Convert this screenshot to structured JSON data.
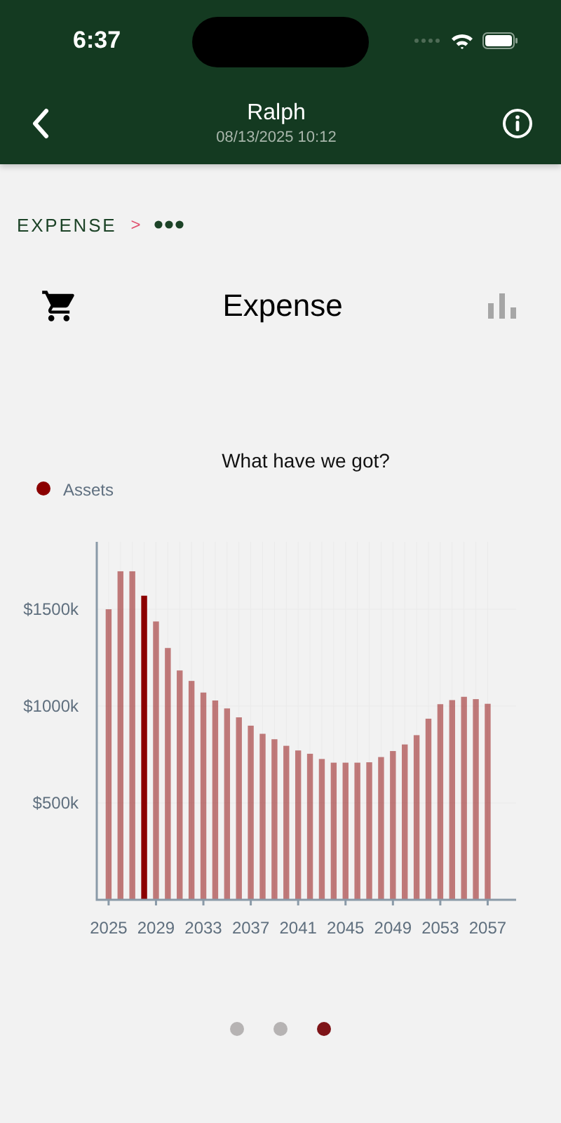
{
  "status_bar": {
    "time": "6:37"
  },
  "nav": {
    "title": "Ralph",
    "subtitle": "08/13/2025 10:12"
  },
  "breadcrumb": {
    "items": [
      "EXPENSE"
    ],
    "separator": ">"
  },
  "page": {
    "title": "Expense"
  },
  "chart": {
    "chart_data": {
      "type": "bar",
      "title": "What have we got?",
      "x": [
        2025,
        2026,
        2027,
        2028,
        2029,
        2030,
        2031,
        2032,
        2033,
        2034,
        2035,
        2036,
        2037,
        2038,
        2039,
        2040,
        2041,
        2042,
        2043,
        2044,
        2045,
        2046,
        2047,
        2048,
        2049,
        2050,
        2051,
        2052,
        2053,
        2054,
        2055,
        2056,
        2057
      ],
      "series": [
        {
          "name": "Assets",
          "color": "#8b0000",
          "values": [
            1500,
            1696,
            1696,
            1570,
            1437,
            1300,
            1184,
            1130,
            1070,
            1029,
            988,
            942,
            899,
            857,
            829,
            795,
            771,
            754,
            727,
            708,
            708,
            708,
            710,
            737,
            768,
            802,
            850,
            935,
            1010,
            1031,
            1048,
            1036,
            1012
          ]
        }
      ],
      "ylim": [
        0,
        1848
      ],
      "yticks": [
        {
          "value": 500,
          "label": "$500k"
        },
        {
          "value": 1000,
          "label": "$1000k"
        },
        {
          "value": 1500,
          "label": "$1500k"
        }
      ],
      "xticks": [
        2025,
        2029,
        2033,
        2037,
        2041,
        2045,
        2049,
        2053,
        2057
      ],
      "xlim": [
        2024,
        2059.4
      ],
      "grid": true
    },
    "bars": [
      {
        "selected": false
      },
      {
        "selected": false
      },
      {
        "selected": false
      },
      {
        "selected": true
      },
      {
        "selected": false
      },
      {
        "selected": false
      },
      {
        "selected": false
      },
      {
        "selected": false
      },
      {
        "selected": false
      },
      {
        "selected": false
      },
      {
        "selected": false
      },
      {
        "selected": false
      },
      {
        "selected": false
      },
      {
        "selected": false
      },
      {
        "selected": false
      },
      {
        "selected": false
      },
      {
        "selected": false
      },
      {
        "selected": false
      },
      {
        "selected": false
      },
      {
        "selected": false
      },
      {
        "selected": false
      },
      {
        "selected": false
      },
      {
        "selected": false
      },
      {
        "selected": false
      },
      {
        "selected": false
      },
      {
        "selected": false
      },
      {
        "selected": false
      },
      {
        "selected": false
      },
      {
        "selected": false
      },
      {
        "selected": false
      },
      {
        "selected": false
      },
      {
        "selected": false
      },
      {
        "selected": false
      }
    ]
  },
  "pager": [
    {
      "selected": false
    },
    {
      "selected": false
    },
    {
      "selected": true
    }
  ]
}
